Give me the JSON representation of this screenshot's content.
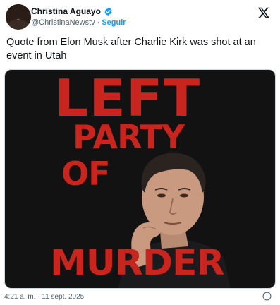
{
  "author": {
    "name": "Christina Aguayo",
    "handle": "@ChristinaNewstv",
    "separator": "·",
    "follow_label": "Seguir",
    "verified_icon": "verified-badge-icon"
  },
  "platform_icon": "x-logo-icon",
  "tweet": {
    "text": "Quote from Elon Musk after Charlie Kirk was shot at an event in Utah"
  },
  "media": {
    "line1": "LEFT",
    "line2": "PARTY",
    "line3": "OF",
    "line4": "MURDER",
    "text_color": "#c9251f",
    "background_color": "#121212"
  },
  "footer": {
    "timestamp": "4:21 a. m. · 11 sept. 2025",
    "info_icon": "info-icon"
  },
  "colors": {
    "accent": "#1d9bf0",
    "secondary_text": "#536471"
  }
}
